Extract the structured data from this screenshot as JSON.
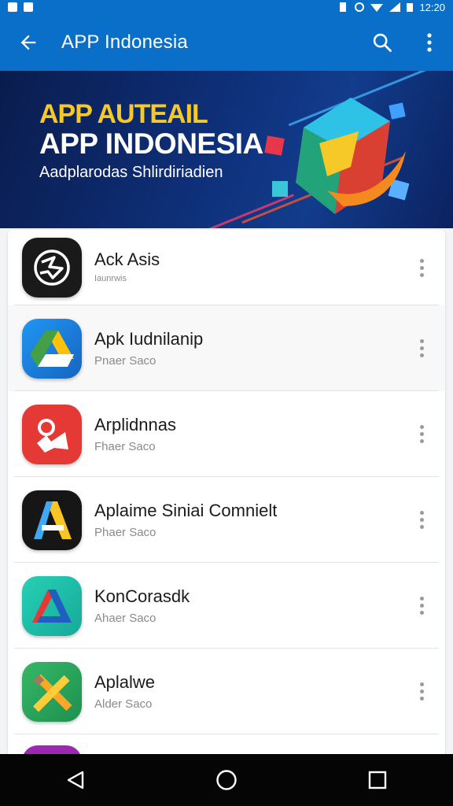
{
  "status_bar": {
    "time": "12:20",
    "left_icons": [
      "notification-icon",
      "mail-icon"
    ],
    "right_icons": [
      "vibrate-icon",
      "alarm-icon",
      "wifi-icon",
      "signal-icon",
      "battery-icon"
    ]
  },
  "app_bar": {
    "title": "APP Indonesia",
    "background": "#0a6fc8",
    "icons": [
      "back-arrow-icon",
      "search-icon",
      "more-vert-icon"
    ]
  },
  "banner": {
    "line1": "APP AUTEAIL",
    "line2": "APP INDONESIA",
    "line3": "Aadplarodas Shlirdiriadien",
    "accent_color": "#f7c928"
  },
  "apps": [
    {
      "name": "Ack Asis",
      "sub": "Iaunrwis",
      "icon": "globe-icon",
      "icon_bg": "#1a1a1a"
    },
    {
      "name": "Apk Iudnilanip",
      "sub": "Pnaer Saco",
      "icon": "triangle-drive-icon",
      "icon_bg": "#1e88e5"
    },
    {
      "name": "Arplidnnas",
      "sub": "Fhaer Saco",
      "icon": "map-pin-icon",
      "icon_bg": "#e53935"
    },
    {
      "name": "Aplaime Siniai Comnielt",
      "sub": "Phaer Saco",
      "icon": "letter-a-icon",
      "icon_bg": "#161616"
    },
    {
      "name": "KonCorasdk",
      "sub": "Ahaer Saco",
      "icon": "delta-icon",
      "icon_bg": "#1ec0a8"
    },
    {
      "name": "Aplalwe",
      "sub": "Alder Saco",
      "icon": "cross-tools-icon",
      "icon_bg": "#2aa85a"
    }
  ],
  "nav_bar": {
    "icons": [
      "back-triangle-icon",
      "home-circle-icon",
      "recents-square-icon"
    ]
  }
}
